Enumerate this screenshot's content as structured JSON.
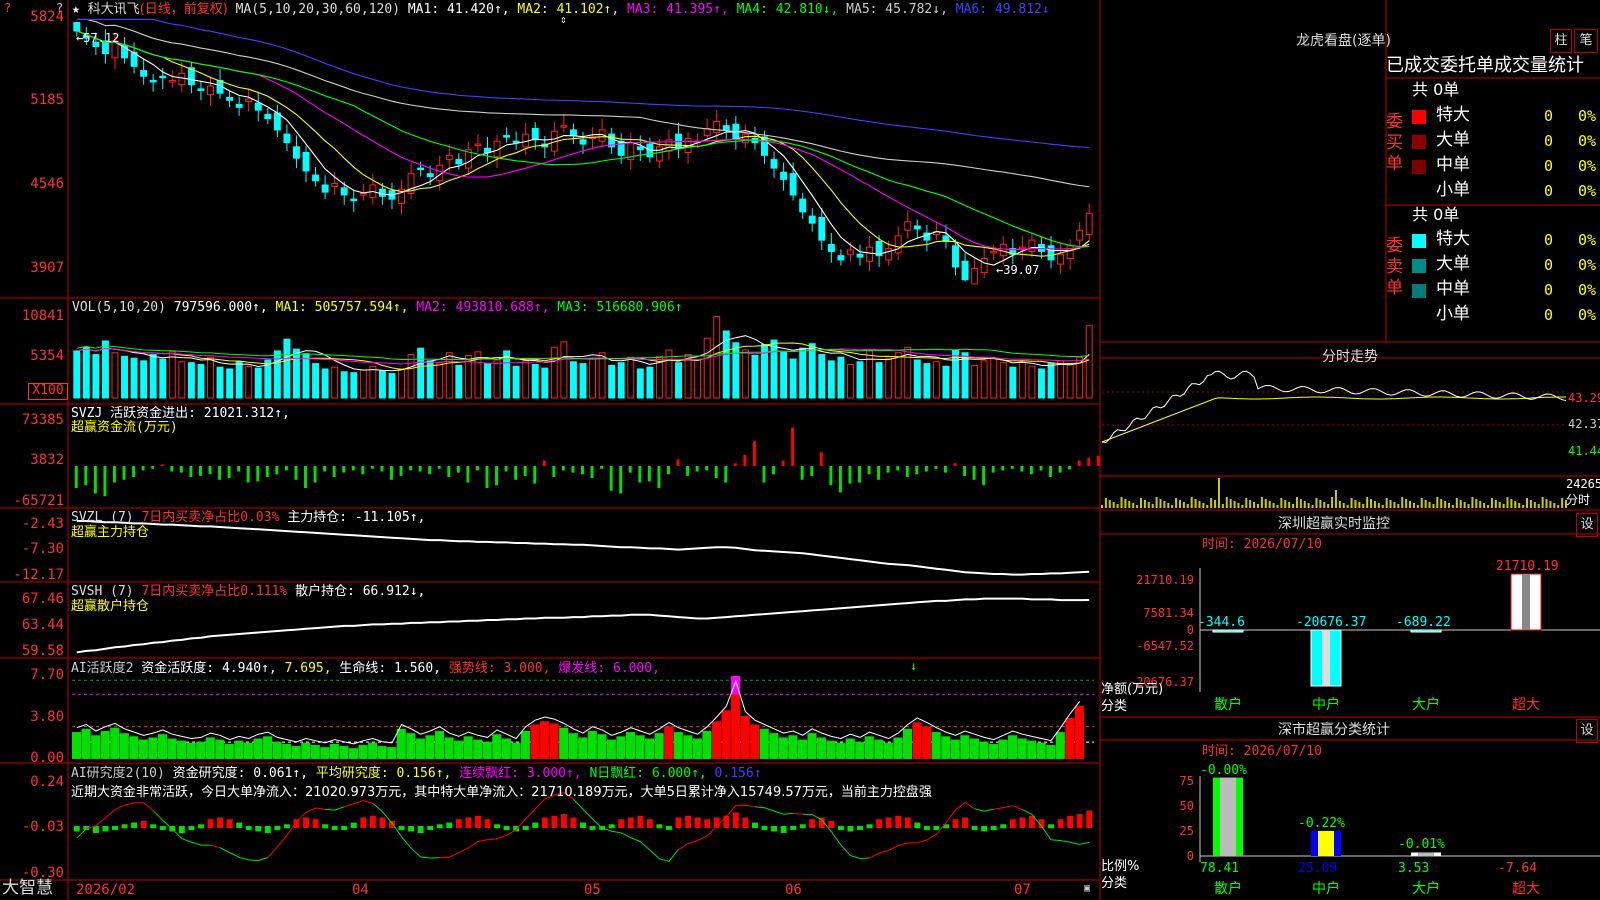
{
  "colors": {
    "up": "#ff2020",
    "down": "#00ffff",
    "frame": "#c00000",
    "bull": "#ff0000",
    "bear": "#00e000"
  },
  "kline": {
    "title_star": "★",
    "stock_name": "科大讯飞",
    "period": "(日线，前复权)",
    "ma_label": "MA(5,10,20,30,60,120)",
    "ma_values": [
      {
        "text": "MA1: 41.420↑,",
        "color": "#ffffff"
      },
      {
        "text": "MA2: 41.102↑,",
        "color": "#ffff00"
      },
      {
        "text": "MA3: 41.395↑,",
        "color": "#ff00ff"
      },
      {
        "text": "MA4: 42.810↓,",
        "color": "#00ff00"
      },
      {
        "text": "MA5: 45.782↓,",
        "color": "#cccccc"
      },
      {
        "text": "MA6: 49.812↓",
        "color": "#4040ff"
      }
    ],
    "y_labels": [
      "5824",
      "5185",
      "4546",
      "3907"
    ],
    "high_note": "←57.12",
    "low_note": "←39.07"
  },
  "volume": {
    "label": "VOL(5,10,20)",
    "values": [
      {
        "text": "797596.000↑,",
        "color": "#ffffff"
      },
      {
        "text": "MA1: 505757.594↑,",
        "color": "#ffff00"
      },
      {
        "text": "MA2: 493810.688↑,",
        "color": "#ff00ff"
      },
      {
        "text": "MA3: 516680.906↑",
        "color": "#00ff00"
      }
    ],
    "y_labels": [
      "10841",
      "5354"
    ],
    "unit": "X100"
  },
  "svzj": {
    "line1": "SVZJ  活跃资金进出: 21021.312↑,",
    "line2": "超赢资金流(万元)",
    "y_labels": [
      "73385",
      "3832",
      "-65721"
    ]
  },
  "svzl": {
    "prefix": "SVZL (7)",
    "ratio": "7日内买卖净占比0.03%",
    "holding": "主力持仓: -11.105↑,",
    "sub": "超赢主力持仓",
    "y_labels": [
      "-2.43",
      "-7.30",
      "-12.17"
    ]
  },
  "svsh": {
    "prefix": "SVSH (7)",
    "ratio": "7日内买卖净占比0.111%",
    "holding": "散户持仓: 66.912↓,",
    "sub": "超赢散户持仓",
    "y_labels": [
      "67.46",
      "63.44",
      "59.58"
    ]
  },
  "ai_active": {
    "parts": [
      {
        "text": "AI活跃度2",
        "color": "#cccccc"
      },
      {
        "text": " 资金活跃度: 4.940↑,",
        "color": "#ffffff"
      },
      {
        "text": " 7.695,",
        "color": "#ffff00"
      },
      {
        "text": " 生命线: 1.560,",
        "color": "#ffffff"
      },
      {
        "text": " 强势线: 3.000,",
        "color": "#ff3030"
      },
      {
        "text": " 爆发线: 6.000,",
        "color": "#ff00ff"
      }
    ],
    "y_labels": [
      "7.70",
      "3.80",
      "0.00"
    ]
  },
  "ai_research": {
    "parts": [
      {
        "text": "AI研究度2(10)",
        "color": "#cccccc"
      },
      {
        "text": " 资金研究度: 0.061↑,",
        "color": "#ffffff"
      },
      {
        "text": " 平均研究度: 0.156↑,",
        "color": "#ffff00"
      },
      {
        "text": " 连续飘红: 3.000↑,",
        "color": "#ff00ff"
      },
      {
        "text": " N日飘红: 6.000↑,",
        "color": "#00ff00"
      },
      {
        "text": " 0.156↑",
        "color": "#4040ff"
      }
    ],
    "comment": "近期大资金非常活跃，今日大单净流入：21020.973万元，其中特大单净流入：21710.189万元，大单5日累计净入15749.57万元，当前主力控盘强",
    "y_labels": [
      "0.24",
      "-0.03",
      "-0.30"
    ]
  },
  "xaxis": {
    "logo": "大智慧",
    "labels": [
      "2026/02",
      "04",
      "05",
      "06",
      "07"
    ]
  },
  "dragon": {
    "title": "龙虎看盘(逐单)",
    "btn1": "柱",
    "btn2": "笔",
    "heading": "已成交委托单成交量统计",
    "buy_label": "委买单",
    "sell_label": "委卖单",
    "buy_total": "共 0单",
    "sell_total": "共 0单",
    "buy_rows": [
      {
        "name": "特大",
        "count": "0",
        "pct": "0%",
        "color": "#ff0000"
      },
      {
        "name": "大单",
        "count": "0",
        "pct": "0%",
        "color": "#8b0000"
      },
      {
        "name": "中单",
        "count": "0",
        "pct": "0%",
        "color": "#7a0000"
      },
      {
        "name": "小单",
        "count": "0",
        "pct": "0%",
        "color": ""
      }
    ],
    "sell_rows": [
      {
        "name": "特大",
        "count": "0",
        "pct": "0%",
        "color": "#00ffff"
      },
      {
        "name": "大单",
        "count": "0",
        "pct": "0%",
        "color": "#008b8b"
      },
      {
        "name": "中单",
        "count": "0",
        "pct": "0%",
        "color": "#007a7a"
      },
      {
        "name": "小单",
        "count": "0",
        "pct": "0%",
        "color": ""
      }
    ]
  },
  "intraday": {
    "title": "分时走势",
    "y_labels": [
      "43.29",
      "42.37",
      "41.44"
    ],
    "vol_label": "24265",
    "vol_unit": "分时"
  },
  "sz_monitor": {
    "title": "深圳超赢实时监控",
    "btn": "设",
    "time": "时间: 2026/07/10",
    "y_labels": [
      "21710.19",
      "7581.34",
      "0",
      "-6547.52",
      "-20676.37"
    ],
    "ylabel": "净额(万元)",
    "xlabel": "分类",
    "categories": [
      "散户",
      "中户",
      "大户",
      "超大"
    ],
    "values": [
      -344.6,
      -20676.37,
      -689.22,
      21710.19
    ],
    "value_labels": [
      "-344.6",
      "-20676.37",
      "-689.22",
      "21710.19"
    ]
  },
  "sz_class": {
    "title": "深市超赢分类统计",
    "btn": "设",
    "time": "时间: 2026/07/10",
    "y_labels": [
      "75",
      "50",
      "25",
      "0"
    ],
    "ylabel": "比例%",
    "xlabel": "分类",
    "categories": [
      "散户",
      "中户",
      "大户",
      "超大"
    ],
    "values": [
      78.41,
      25.09,
      3.53,
      -7.64
    ],
    "changes": [
      "-0.00%",
      "-0.22%",
      "-0.01%",
      ""
    ]
  },
  "chart_data": [
    {
      "type": "candlestick",
      "title": "科大讯飞(日线，前复权)",
      "x_axis_labels": [
        "2026/02",
        "04",
        "05",
        "06",
        "07"
      ],
      "y_tick_labels": [
        "5824",
        "5185",
        "4546",
        "3907"
      ],
      "annotations": [
        "←57.12",
        "←39.07"
      ],
      "series": [
        {
          "name": "MA1",
          "last": 41.42
        },
        {
          "name": "MA2",
          "last": 41.102
        },
        {
          "name": "MA3",
          "last": 41.395
        },
        {
          "name": "MA4",
          "last": 42.81
        },
        {
          "name": "MA5",
          "last": 45.782
        },
        {
          "name": "MA6",
          "last": 49.812
        }
      ],
      "close": [
        56.8,
        56.3,
        55.7,
        55.2,
        56.1,
        54.9,
        54.3,
        53.6,
        53.2,
        53.5,
        53.3,
        53.8,
        53.0,
        52.6,
        52.9,
        52.4,
        51.9,
        51.4,
        52.0,
        51.2,
        50.6,
        49.8,
        48.9,
        47.8,
        46.9,
        46.2,
        45.4,
        46.0,
        45.2,
        44.8,
        45.3,
        45.9,
        45.1,
        44.9,
        45.6,
        46.7,
        47.0,
        46.5,
        47.3,
        48.0,
        47.4,
        48.4,
        48.8,
        48.2,
        49.0,
        49.3,
        48.9,
        49.5,
        49.1,
        48.6,
        49.7,
        50.1,
        49.4,
        48.8,
        49.3,
        49.8,
        48.6,
        48.0,
        48.9,
        48.4,
        47.9,
        48.6,
        49.1,
        48.5,
        49.2,
        49.0,
        49.9,
        50.4,
        49.8,
        49.2,
        49.5,
        48.9,
        48.0,
        47.1,
        46.3,
        45.2,
        44.0,
        43.2,
        42.0,
        41.2,
        40.6,
        41.3,
        40.8,
        41.5,
        40.9,
        41.4,
        42.3,
        43.3,
        42.8,
        42.0,
        42.6,
        41.9,
        40.1,
        39.2,
        40.0,
        40.7,
        41.2,
        41.7,
        41.0,
        41.5,
        42.0,
        41.2,
        40.6,
        41.0,
        41.6,
        42.7,
        43.9
      ],
      "ylim": [
        39.07,
        57.12
      ]
    },
    {
      "type": "bar",
      "title": "VOL(5,10,20)",
      "y_tick_labels": [
        "10841",
        "5354"
      ],
      "values": [
        5.2,
        5.6,
        4.8,
        6.3,
        5.0,
        4.6,
        4.4,
        4.1,
        4.8,
        4.3,
        5.1,
        4.0,
        3.9,
        3.7,
        4.5,
        3.4,
        3.2,
        4.0,
        3.5,
        3.3,
        4.2,
        5.2,
        6.5,
        5.4,
        4.9,
        3.8,
        3.2,
        3.4,
        2.9,
        2.8,
        3.1,
        3.5,
        3.0,
        2.7,
        3.2,
        4.8,
        5.5,
        4.1,
        3.9,
        5.0,
        3.6,
        4.7,
        5.1,
        3.8,
        4.2,
        5.2,
        3.5,
        4.1,
        3.7,
        3.3,
        5.6,
        6.2,
        4.0,
        3.8,
        4.3,
        5.0,
        3.6,
        3.9,
        4.5,
        3.2,
        3.4,
        4.6,
        5.3,
        3.9,
        4.8,
        4.2,
        6.6,
        9.0,
        7.4,
        6.1,
        5.3,
        4.7,
        5.9,
        6.4,
        5.1,
        4.3,
        5.5,
        6.0,
        4.8,
        4.1,
        4.5,
        3.7,
        4.0,
        5.2,
        3.9,
        4.4,
        5.0,
        5.6,
        4.2,
        3.8,
        4.0,
        3.5,
        5.3,
        5.0,
        3.6,
        4.1,
        4.4,
        3.9,
        3.4,
        4.0,
        3.5,
        3.2,
        3.8,
        4.1,
        3.7,
        4.5,
        7.98
      ]
    },
    {
      "type": "bar",
      "title": "SVZJ 活跃资金进出",
      "ylabel": "超赢资金流(万元)",
      "y_tick_labels": [
        "73385",
        "3832",
        "-65721"
      ],
      "values": [
        -40,
        -35,
        -50,
        -55,
        -30,
        -25,
        -20,
        -8,
        -5,
        3,
        -10,
        -12,
        -20,
        -18,
        -15,
        -25,
        -22,
        -10,
        -30,
        -28,
        -20,
        -15,
        -8,
        -25,
        -40,
        -30,
        -10,
        -20,
        -12,
        -8,
        -15,
        -5,
        -10,
        -25,
        -18,
        -8,
        -10,
        -15,
        -5,
        -20,
        -12,
        -30,
        -8,
        -40,
        -35,
        -10,
        -25,
        -18,
        -32,
        10,
        -20,
        -8,
        -12,
        -15,
        -22,
        -5,
        -45,
        -50,
        -12,
        -30,
        -28,
        -40,
        -15,
        12,
        -18,
        -10,
        -8,
        -22,
        -30,
        5,
        20,
        45,
        -30,
        -15,
        10,
        70,
        -25,
        -18,
        25,
        -35,
        -48,
        -32,
        -30,
        -15,
        -25,
        -12,
        -8,
        -20,
        -15,
        -10,
        -5,
        -12,
        5,
        -18,
        -25,
        -35,
        -12,
        -8,
        -5,
        -10,
        -15,
        -8,
        -20,
        -12,
        -6,
        10,
        15,
        18.5
      ]
    },
    {
      "type": "line",
      "title": "SVZL 主力持仓",
      "y_tick_labels": [
        "-2.43",
        "-7.30",
        "-12.17"
      ],
      "values": [
        -2.6,
        -2.6,
        -2.7,
        -2.8,
        -2.8,
        -2.9,
        -3.0,
        -3.0,
        -3.1,
        -3.2,
        -3.2,
        -3.3,
        -3.4,
        -3.5,
        -3.5,
        -3.6,
        -3.7,
        -3.8,
        -3.9,
        -4.0,
        -4.1,
        -4.2,
        -4.3,
        -4.4,
        -4.5,
        -4.6,
        -4.7,
        -4.8,
        -4.9,
        -5.0,
        -5.1,
        -5.2,
        -5.3,
        -5.4,
        -5.5,
        -5.6,
        -5.7,
        -5.8,
        -5.8,
        -5.9,
        -6.0,
        -6.0,
        -6.1,
        -6.1,
        -6.2,
        -6.2,
        -6.3,
        -6.3,
        -6.4,
        -6.4,
        -6.5,
        -6.5,
        -6.6,
        -6.6,
        -6.7,
        -6.8,
        -6.9,
        -7.0,
        -7.0,
        -7.1,
        -7.2,
        -7.2,
        -7.3,
        -7.4,
        -7.3,
        -7.2,
        -7.1,
        -7.0,
        -7.0,
        -7.1,
        -7.3,
        -7.5,
        -7.6,
        -7.7,
        -7.8,
        -7.9,
        -8.0,
        -8.2,
        -8.4,
        -8.6,
        -8.8,
        -9.0,
        -9.2,
        -9.4,
        -9.6,
        -9.8,
        -9.9,
        -10.0,
        -10.2,
        -10.4,
        -10.6,
        -10.8,
        -11.0,
        -11.2,
        -11.3,
        -11.4,
        -11.5,
        -11.5,
        -11.6,
        -11.6,
        -11.5,
        -11.5,
        -11.4,
        -11.4,
        -11.3,
        -11.2,
        -11.105
      ]
    },
    {
      "type": "line",
      "title": "SVSH 散户持仓",
      "y_tick_labels": [
        "67.46",
        "63.44",
        "59.58"
      ],
      "values": [
        59.8,
        60.0,
        60.1,
        60.3,
        60.5,
        60.6,
        60.8,
        60.9,
        61.1,
        61.2,
        61.4,
        61.5,
        61.7,
        61.8,
        62.0,
        62.1,
        62.2,
        62.3,
        62.4,
        62.5,
        62.6,
        62.7,
        62.8,
        62.9,
        63.0,
        63.1,
        63.2,
        63.3,
        63.4,
        63.4,
        63.5,
        63.6,
        63.6,
        63.7,
        63.7,
        63.8,
        63.8,
        63.9,
        63.9,
        64.0,
        64.0,
        64.1,
        64.1,
        64.2,
        64.2,
        64.3,
        64.3,
        64.4,
        64.4,
        64.5,
        64.5,
        64.5,
        64.6,
        64.6,
        64.7,
        64.7,
        64.8,
        64.8,
        64.9,
        64.9,
        64.9,
        64.8,
        64.7,
        64.6,
        64.5,
        64.4,
        64.4,
        64.5,
        64.6,
        64.7,
        64.8,
        64.9,
        65.0,
        65.1,
        65.2,
        65.3,
        65.4,
        65.5,
        65.6,
        65.7,
        65.8,
        65.9,
        66.0,
        66.1,
        66.2,
        66.3,
        66.4,
        66.5,
        66.6,
        66.7,
        66.8,
        66.8,
        66.9,
        67.0,
        67.0,
        67.1,
        67.1,
        67.1,
        67.1,
        67.1,
        67.0,
        67.0,
        67.0,
        66.9,
        66.9,
        66.9,
        66.912
      ]
    },
    {
      "type": "bar",
      "title": "AI活跃度2",
      "y_tick_labels": [
        "7.70",
        "3.80",
        "0.00"
      ],
      "values": [
        2.5,
        2.8,
        2.2,
        2.6,
        2.9,
        2.4,
        2.1,
        1.8,
        2.0,
        2.3,
        1.9,
        1.7,
        1.5,
        1.6,
        2.0,
        1.8,
        1.4,
        1.7,
        1.5,
        1.9,
        2.1,
        1.6,
        1.4,
        1.2,
        1.5,
        1.3,
        1.1,
        1.4,
        1.2,
        1.0,
        1.3,
        1.5,
        1.2,
        1.1,
        2.8,
        2.4,
        1.9,
        2.2,
        2.6,
        2.0,
        1.7,
        2.1,
        1.8,
        1.6,
        2.3,
        1.9,
        1.5,
        2.6,
        3.2,
        3.5,
        3.3,
        2.9,
        2.4,
        2.0,
        2.6,
        2.3,
        1.8,
        2.1,
        2.5,
        2.2,
        1.9,
        2.4,
        3.0,
        2.5,
        2.2,
        1.9,
        2.6,
        3.5,
        4.5,
        6.8,
        4.0,
        3.2,
        2.8,
        2.4,
        2.0,
        2.2,
        1.8,
        2.4,
        2.0,
        1.7,
        1.5,
        1.9,
        1.6,
        2.1,
        1.8,
        1.5,
        2.0,
        2.8,
        3.4,
        3.0,
        2.5,
        2.1,
        1.8,
        2.2,
        1.9,
        1.6,
        1.4,
        1.8,
        2.2,
        1.9,
        1.7,
        1.5,
        1.3,
        2.5,
        3.8,
        4.94
      ],
      "reference_lines": [
        {
          "name": "生命线",
          "value": 1.56
        },
        {
          "name": "强势线",
          "value": 3.0
        },
        {
          "name": "爆发线",
          "value": 6.0
        }
      ]
    },
    {
      "type": "bar",
      "title": "AI研究度2(10)",
      "y_tick_labels": [
        "0.24",
        "-0.03",
        "-0.30"
      ],
      "values": [
        -0.05,
        -0.04,
        -0.06,
        -0.05,
        -0.03,
        -0.02,
        -0.01,
        0.0,
        -0.02,
        -0.04,
        -0.05,
        -0.06,
        -0.04,
        -0.02,
        0.01,
        0.02,
        0.01,
        -0.01,
        -0.03,
        -0.05,
        -0.06,
        -0.04,
        -0.02,
        0.01,
        0.02,
        0.01,
        -0.02,
        -0.04,
        -0.03,
        -0.01,
        0.02,
        0.03,
        0.02,
        0.0,
        -0.03,
        -0.05,
        -0.06,
        -0.04,
        -0.02,
        -0.01,
        0.01,
        0.02,
        0.03,
        0.01,
        -0.02,
        -0.04,
        -0.05,
        -0.03,
        -0.01,
        0.02,
        0.03,
        0.04,
        0.02,
        -0.01,
        -0.03,
        -0.04,
        -0.02,
        0.01,
        0.02,
        0.03,
        0.01,
        -0.02,
        -0.03,
        0.02,
        0.03,
        0.02,
        0.01,
        0.02,
        0.03,
        0.05,
        0.02,
        -0.01,
        -0.03,
        -0.05,
        -0.06,
        -0.04,
        -0.02,
        0.01,
        0.02,
        0.0,
        -0.03,
        -0.05,
        -0.04,
        -0.02,
        0.01,
        0.02,
        0.03,
        0.02,
        -0.01,
        -0.03,
        -0.04,
        -0.02,
        0.01,
        0.02,
        -0.03,
        -0.05,
        -0.04,
        -0.02,
        0.01,
        0.02,
        0.03,
        0.01,
        -0.02,
        0.01,
        0.03,
        0.04,
        0.061
      ]
    },
    {
      "type": "bar",
      "title": "深圳超赢实时监控",
      "categories": [
        "散户",
        "中户",
        "大户",
        "超大"
      ],
      "values": [
        -344.6,
        -20676.37,
        -689.22,
        21710.19
      ],
      "ylabel": "净额(万元)",
      "xlabel": "分类"
    },
    {
      "type": "bar",
      "title": "深市超赢分类统计",
      "categories": [
        "散户",
        "中户",
        "大户",
        "超大"
      ],
      "values": [
        78.41,
        25.09,
        3.53,
        -7.64
      ],
      "ylabel": "比例%",
      "xlabel": "分类"
    }
  ]
}
